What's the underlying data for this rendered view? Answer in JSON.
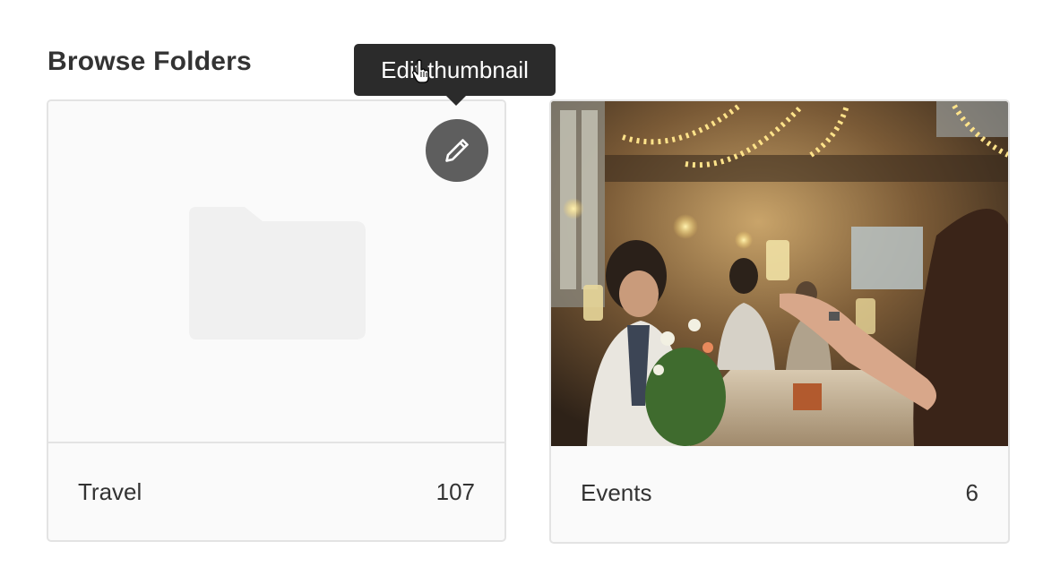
{
  "section": {
    "title": "Browse Folders"
  },
  "folders": [
    {
      "name": "Travel",
      "count": "107",
      "thumbnail": "folder-placeholder-icon"
    },
    {
      "name": "Events",
      "count": "6",
      "thumbnail": "party-celebration-photo"
    }
  ],
  "edit_thumbnail": {
    "icon": "pencil-icon",
    "tooltip": "Edit thumbnail"
  },
  "colors": {
    "card_border": "#e3e3e3",
    "card_background": "#fafafa",
    "edit_button": "#5e5e5e",
    "tooltip_background": "#2b2b2b"
  }
}
